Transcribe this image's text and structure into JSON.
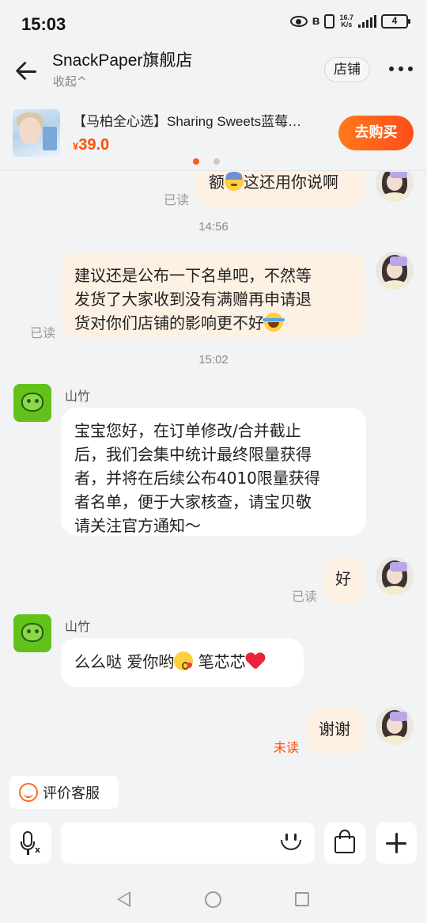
{
  "status_bar": {
    "time": "15:03",
    "net_speed_value": "16.7",
    "net_speed_unit": "K/s",
    "battery": "4"
  },
  "header": {
    "shop_name": "SnackPaper旗舰店",
    "collapse_label": "收起^",
    "shop_button": "店铺",
    "more_icon": "more-dots-icon"
  },
  "product": {
    "title": "【马柏全心选】Sharing Sweets蓝莓…",
    "currency": "¥",
    "price": "39.0",
    "buy_label": "去购买",
    "carousel_active_index": 0,
    "carousel_count": 2
  },
  "messages": {
    "m1": {
      "text": "额",
      "text_after": "这还用你说啊",
      "status": "已读",
      "emoji": "sweat-emoji"
    },
    "ts1": "14:56",
    "m2": {
      "line1": "建议还是公布一下名单吧，不然等",
      "line2": "发货了大家收到没有满赠再申请退",
      "line3": "货对你们店铺的影响更不好",
      "status": "已读",
      "emoji": "joy-emoji"
    },
    "ts2": "15:02",
    "m3": {
      "sender": "山竹",
      "line1": "宝宝您好，在订单修改/合并截止",
      "line2": "后，我们会集中统计最终限量获得",
      "line3": "者，并将在后续公布4010限量获得",
      "line4": "者名单，便于大家核查，请宝贝敬",
      "line5": "请关注官方通知～"
    },
    "m4": {
      "text": "好",
      "status": "已读"
    },
    "m5": {
      "sender": "山竹",
      "text_a": "么么哒 爱你哟",
      "text_b": " 笔芯芯",
      "emoji": "kiss-emoji",
      "heart": "heart-icon"
    },
    "m6": {
      "text": "谢谢",
      "status": "未读"
    }
  },
  "review": {
    "label": "评价客服",
    "icon": "smile-icon"
  },
  "input": {
    "placeholder": "",
    "voice_icon": "microphone-icon",
    "emoji_icon": "emoji-icon",
    "bag_icon": "shopping-bag-icon",
    "plus_icon": "plus-icon"
  },
  "colors": {
    "accent": "#ff5000",
    "bubble_self": "#fdf1e4",
    "bubble_other": "#ffffff",
    "shop_avatar": "#62c21b"
  }
}
